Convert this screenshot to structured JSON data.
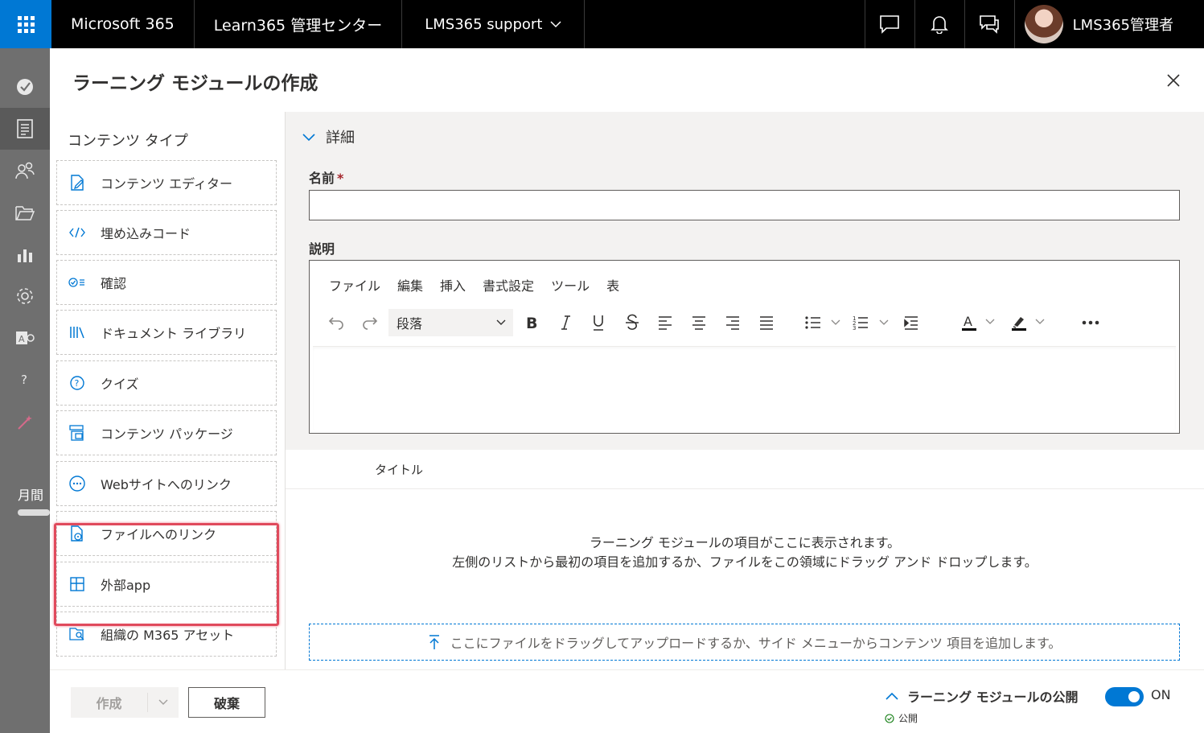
{
  "topbar": {
    "brand": "Microsoft 365",
    "app_name": "Learn365 管理センター",
    "site_name": "LMS365 support",
    "user_name": "LMS365管理者"
  },
  "rail": {
    "items": [
      "check-icon",
      "document-icon",
      "people-icon",
      "folder-icon",
      "chart-icon",
      "gear-icon",
      "exam-icon",
      "help-icon",
      "wand-icon"
    ],
    "partial_text": "月間"
  },
  "panel": {
    "title": "ラーニング モジュールの作成",
    "content_types_heading": "コンテンツ タイプ",
    "content_types": [
      {
        "label": "コンテンツ エディター",
        "icon": "edit-document-icon"
      },
      {
        "label": "埋め込みコード",
        "icon": "code-icon"
      },
      {
        "label": "確認",
        "icon": "checklist-icon"
      },
      {
        "label": "ドキュメント ライブラリ",
        "icon": "library-icon"
      },
      {
        "label": "クイズ",
        "icon": "question-icon"
      },
      {
        "label": "コンテンツ パッケージ",
        "icon": "package-icon"
      },
      {
        "label": "Webサイトへのリンク",
        "icon": "web-link-icon"
      },
      {
        "label": "ファイルへのリンク",
        "icon": "file-link-icon"
      },
      {
        "label": "外部app",
        "icon": "app-icon"
      },
      {
        "label": "組織の M365 アセット",
        "icon": "m365-asset-icon"
      }
    ],
    "details_heading": "詳細",
    "name_label": "名前",
    "name_required_mark": "*",
    "name_value": "",
    "description_label": "説明",
    "editor_menu": [
      "ファイル",
      "編集",
      "挿入",
      "書式設定",
      "ツール",
      "表"
    ],
    "paragraph_select": "段落",
    "items_column_title": "タイトル",
    "empty_line1": "ラーニング モジュールの項目がここに表示されます。",
    "empty_line2": "左側のリストから最初の項目を追加するか、ファイルをこの領域にドラッグ アンド ドロップします。",
    "dropzone_text": "ここにファイルをドラッグしてアップロードするか、サイド メニューからコンテンツ 項目を追加します。"
  },
  "footer": {
    "create_label": "作成",
    "discard_label": "破棄",
    "publish_label": "ラーニング モジュールの公開",
    "publish_status": "公開",
    "toggle_label": "ON",
    "toggle_on": true
  },
  "colors": {
    "accent": "#0078d4",
    "highlight": "#e04a5c",
    "topbar": "#000000"
  }
}
